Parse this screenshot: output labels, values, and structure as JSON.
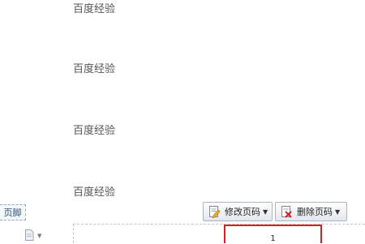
{
  "document": {
    "lines": [
      "百度经验",
      "百度经验",
      "百度经验",
      "百度经验"
    ]
  },
  "footer": {
    "section_label": "页脚",
    "page_number_value": "1"
  },
  "toolbar": {
    "modify_page_number_label": "修改页码",
    "delete_page_number_label": "删除页码"
  },
  "icons": {
    "modify": "edit-page-icon",
    "delete": "delete-page-icon",
    "margin": "page-icon"
  },
  "colors": {
    "highlight_border": "#d62020",
    "footer_tag_border": "#8fa9c9"
  }
}
